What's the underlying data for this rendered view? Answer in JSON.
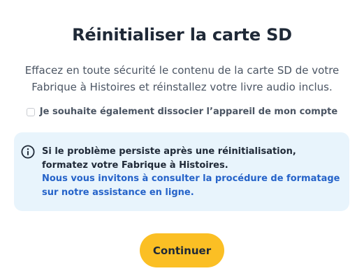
{
  "dialog": {
    "title": "Réinitialiser la carte SD",
    "description": "Effacez en toute sécurité le contenu de la carte SD de votre Fabrique à Histoires et réinstallez votre livre audio inclus.",
    "checkbox": {
      "label": "Je souhaite également dissocier l’appareil de mon compte",
      "checked": false
    },
    "info": {
      "icon": "info-icon",
      "strong_text": "Si le problème persiste après une réinitialisation, formatez votre Fabrique à Histoires.",
      "prefix_text": "Nous vous invitons à ",
      "link_text": "consulter la procédure de formatage sur notre assistance en ligne."
    },
    "continue_label": "Continuer"
  },
  "colors": {
    "accent_button": "#fbbf24",
    "info_background": "#e8f4fc",
    "link": "#2563c9",
    "title": "#1f2937"
  }
}
